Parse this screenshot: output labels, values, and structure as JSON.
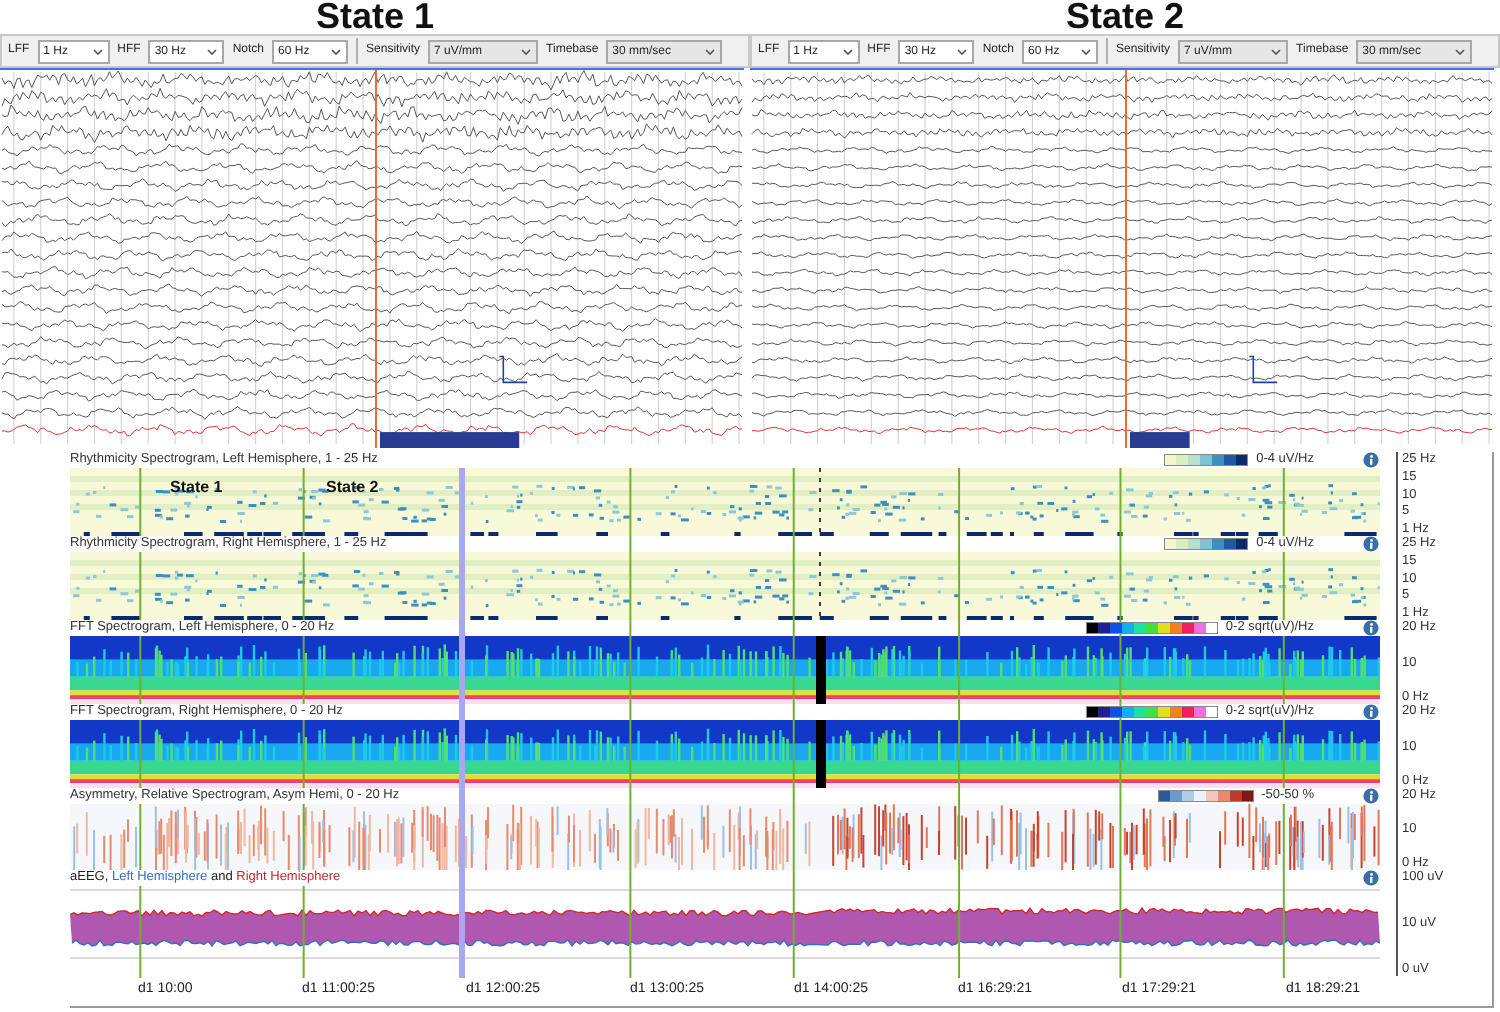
{
  "panes": [
    {
      "heading": "State 1",
      "toolbar": [
        {
          "label": "LFF",
          "value": "1 Hz"
        },
        {
          "label": "HFF",
          "value": "30 Hz"
        },
        {
          "label": "Notch",
          "value": "60 Hz"
        },
        {
          "label": "Sensitivity",
          "value": "7 uV/mm"
        },
        {
          "label": "Timebase",
          "value": "30 mm/sec"
        }
      ]
    },
    {
      "heading": "State 2",
      "toolbar": [
        {
          "label": "LFF",
          "value": "1 Hz"
        },
        {
          "label": "HFF",
          "value": "30 Hz"
        },
        {
          "label": "Notch",
          "value": "60 Hz"
        },
        {
          "label": "Sensitivity",
          "value": "7 uV/mm"
        },
        {
          "label": "Timebase",
          "value": "30 mm/sec"
        }
      ]
    }
  ],
  "trends": {
    "rows": [
      {
        "kind": "rhythmicity",
        "title": "Rhythmicity Spectrogram, Left Hemisphere, 1 - 25 Hz",
        "scale": "0-4 uV/Hz",
        "axis": [
          "25 Hz",
          "15",
          "10",
          "5",
          "1 Hz"
        ],
        "overlay_labels": [
          "State 1",
          "State 2"
        ]
      },
      {
        "kind": "rhythmicity",
        "title": "Rhythmicity Spectrogram, Right Hemisphere, 1 - 25 Hz",
        "scale": "0-4 uV/Hz",
        "axis": [
          "25 Hz",
          "15",
          "10",
          "5",
          "1 Hz"
        ]
      },
      {
        "kind": "fft",
        "title": "FFT Spectrogram, Left Hemisphere, 0 - 20 Hz",
        "scale": "0-2 sqrt(uV)/Hz",
        "axis": [
          "20 Hz",
          "10",
          "0 Hz"
        ]
      },
      {
        "kind": "fft",
        "title": "FFT Spectrogram, Right Hemisphere, 0 - 20 Hz",
        "scale": "0-2 sqrt(uV)/Hz",
        "axis": [
          "20 Hz",
          "10",
          "0 Hz"
        ]
      },
      {
        "kind": "asymmetry",
        "title": "Asymmetry, Relative Spectrogram, Asym Hemi, 0 - 20 Hz",
        "scale": "-50-50 %",
        "axis": [
          "20 Hz",
          "10",
          "0 Hz"
        ]
      },
      {
        "kind": "aeeg",
        "title_parts": [
          {
            "text": "aEEG, ",
            "color": "#222222"
          },
          {
            "text": "Left Hemisphere",
            "color": "#2f6fc0"
          },
          {
            "text": " and ",
            "color": "#222222"
          },
          {
            "text": "Right Hemisphere",
            "color": "#c0282d"
          }
        ],
        "axis": [
          "100 uV",
          "10 uV",
          "0 uV"
        ]
      }
    ],
    "times": [
      "d1 10:00",
      "d1 11:00:25",
      "d1 12:00:25",
      "d1 13:00:25",
      "d1 14:00:25",
      "d1 16:29:21",
      "d1 17:29:21",
      "d1 18:29:21"
    ]
  }
}
